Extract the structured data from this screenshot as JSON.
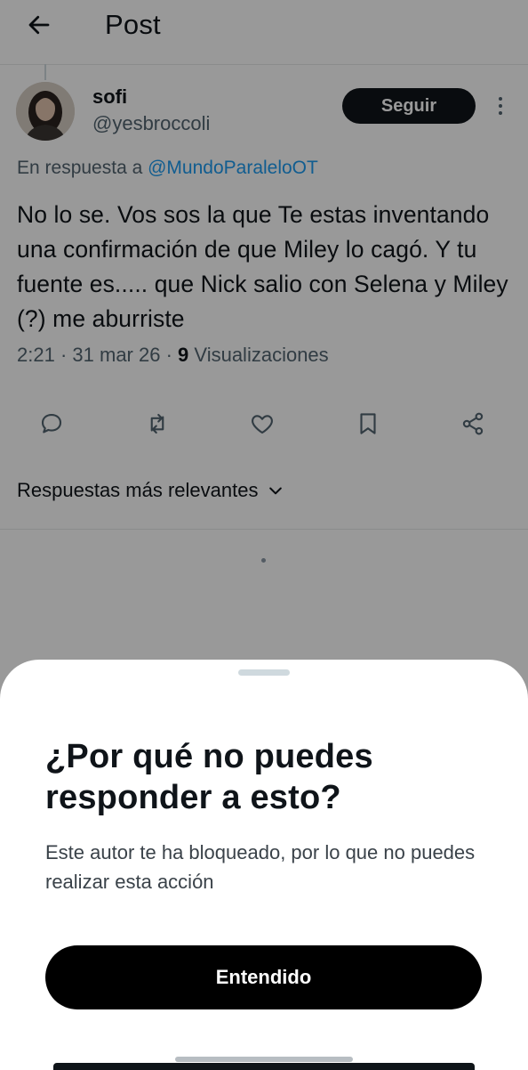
{
  "header": {
    "title": "Post"
  },
  "post": {
    "author_name": "sofi",
    "author_handle": "@yesbroccoli",
    "follow_label": "Seguir",
    "reply_prefix": "En respuesta a",
    "reply_to": "@MundoParaleloOT",
    "text": "No lo se. Vos sos la que Te estas inventando una confirmación de que Miley lo cagó. Y tu fuente es..... que Nick salio con Selena y Miley (?) me aburriste",
    "time": "2:21",
    "date": "31 mar 26",
    "views_count": "9",
    "views_label": "Visualizaciones"
  },
  "sort": {
    "label": "Respuestas más relevantes"
  },
  "sheet": {
    "title": "¿Por qué no puedes responder a esto?",
    "body": "Este autor te ha bloqueado, por lo que no puedes realizar esta acción",
    "button_label": "Entendido"
  },
  "icons": {
    "back": "arrow-left-icon",
    "more": "more-vertical-icon",
    "reply": "reply-icon",
    "repost": "repost-icon",
    "like": "heart-icon",
    "bookmark": "bookmark-icon",
    "share": "share-icon",
    "chevron": "chevron-down-icon"
  },
  "colors": {
    "link": "#1d9bf0",
    "text_primary": "#0f1419",
    "text_secondary": "#536471",
    "button_bg": "#000000"
  }
}
